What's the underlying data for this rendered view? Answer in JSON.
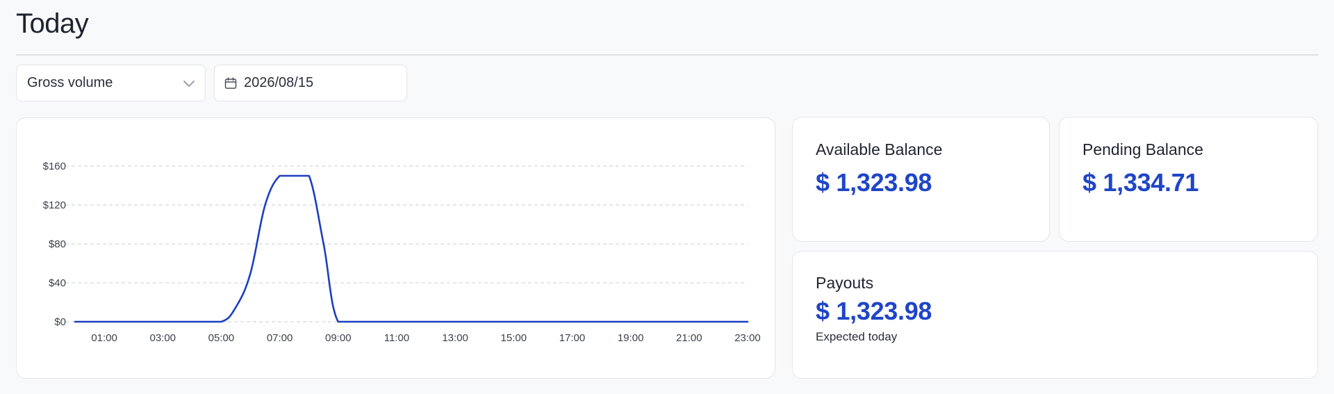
{
  "page": {
    "title": "Today"
  },
  "filters": {
    "metric": {
      "selected": "Gross volume",
      "icon": "chevron-down-icon"
    },
    "date": {
      "value": "2026/08/15",
      "icon": "calendar-icon"
    }
  },
  "balances": {
    "available": {
      "label": "Available Balance",
      "amount": "$ 1,323.98"
    },
    "pending": {
      "label": "Pending Balance",
      "amount": "$ 1,334.71"
    }
  },
  "payouts": {
    "label": "Payouts",
    "amount": "$ 1,323.98",
    "note": "Expected today"
  },
  "colors": {
    "accent": "#1f45c7",
    "line": "#1c3fbf"
  },
  "chart_data": {
    "type": "line",
    "x": [
      "00:00",
      "01:00",
      "02:00",
      "03:00",
      "04:00",
      "05:00",
      "05:30",
      "06:00",
      "06:30",
      "07:00",
      "07:30",
      "08:00",
      "08:30",
      "09:00",
      "10:00",
      "11:00",
      "12:00",
      "13:00",
      "14:00",
      "15:00",
      "16:00",
      "17:00",
      "18:00",
      "19:00",
      "20:00",
      "21:00",
      "22:00",
      "23:00"
    ],
    "xticks": [
      "01:00",
      "03:00",
      "05:00",
      "07:00",
      "09:00",
      "11:00",
      "13:00",
      "15:00",
      "17:00",
      "19:00",
      "21:00",
      "23:00"
    ],
    "series": [
      {
        "values": [
          0,
          0,
          0,
          0,
          0,
          0,
          15,
          50,
          120,
          150,
          150,
          150,
          80,
          0,
          0,
          0,
          0,
          0,
          0,
          0,
          0,
          0,
          0,
          0,
          0,
          0,
          0,
          0
        ]
      }
    ],
    "yticks": [
      "$0",
      "$40",
      "$80",
      "$120",
      "$160"
    ],
    "ylim": [
      0,
      160
    ],
    "grid": true
  }
}
